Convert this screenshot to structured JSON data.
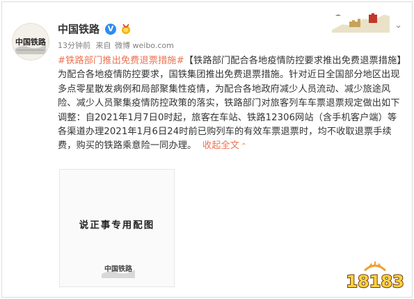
{
  "post": {
    "username": "中国铁路",
    "verified_badge": "V",
    "time": "13分钟前",
    "source_label": "来自",
    "source": "微博 weibo.com",
    "topic": "#铁路部门推出免费退票措施#",
    "body": "【铁路部门配合各地疫情防控要求推出免费退票措施】为配合各地疫情防控要求，国铁集团推出免费退票措施。针对近日全国部分地区出现多点零星散发病例和局部聚集性疫情，为配合各地政府减少人员流动、减少旅途风险、减少人员聚集疫情防控政策的落实，铁路部门对旅客列车车票退票规定做出如下调整：自2021年1月7日0时起，旅客在车站、铁路12306网站（含手机客户端）等各渠道办理2021年1月6日24时前已购列车的有效车票退票时，均不收取退票手续费，购买的铁路乘意险一同办理。",
    "collapse_label": "收起全文",
    "collapse_icon": "chevron-up-icon",
    "menu_icon": "chevron-down-icon"
  },
  "image": {
    "caption": "说正事专用配图",
    "logo": "中国铁路"
  },
  "watermark": {
    "text": "18183"
  },
  "colors": {
    "link": "#eb7350",
    "verified": "#2d8cf0",
    "text": "#333333",
    "meta": "#808080"
  }
}
